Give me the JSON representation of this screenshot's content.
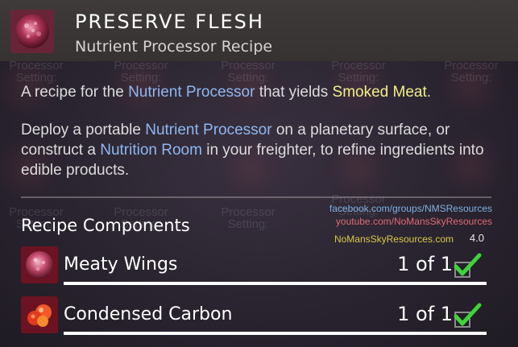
{
  "header": {
    "title": "PRESERVE FLESH",
    "subtitle": "Nutrient Processor Recipe",
    "icon": "preserve-flesh-item-icon"
  },
  "description": {
    "p1": {
      "pre": "A recipe for the ",
      "link1": "Nutrient Processor",
      "mid": " that yields ",
      "product": "Smoked Meat",
      "post": "."
    },
    "p2": {
      "pre": "Deploy a portable ",
      "link1": "Nutrient Processor",
      "mid1": " on a planetary surface, or construct a ",
      "link2": "Nutrition Room",
      "post": " in your freighter, to refine ingredients into edible products."
    }
  },
  "background_labels": [
    {
      "line1": "Processor",
      "line2": "Setting:"
    },
    {
      "line1": "Processor",
      "line2": "Setting:"
    },
    {
      "line1": "Processor",
      "line2": "Setting:"
    },
    {
      "line1": "Processor",
      "line2": "Setting:"
    },
    {
      "line1": "Processor",
      "line2": "Setting:"
    },
    {
      "line1": "Processor",
      "line2": "Setting:"
    },
    {
      "line1": "Processor",
      "line2": "Setting:"
    },
    {
      "line1": "Processor",
      "line2": "Setting:"
    },
    {
      "line1": "Processor",
      "line2": "Setting:"
    }
  ],
  "components": {
    "title": "Recipe Components",
    "items": [
      {
        "name": "Meaty Wings",
        "count": "1 of 1",
        "icon": "meaty-wings-icon",
        "status": "check-icon"
      },
      {
        "name": "Condensed Carbon",
        "count": "1 of 1",
        "icon": "condensed-carbon-icon",
        "status": "check-icon"
      }
    ]
  },
  "watermark": {
    "line1": "facebook.com/groups/NMSResources",
    "line2": "youtube.com/NoMansSkyResources",
    "line3": "NoMansSkyResources.com",
    "version": "4.0"
  },
  "colors": {
    "link_blue": "#8fb7f0",
    "product_yellow": "#f2ef8a",
    "check_green": "#3fd43a"
  }
}
